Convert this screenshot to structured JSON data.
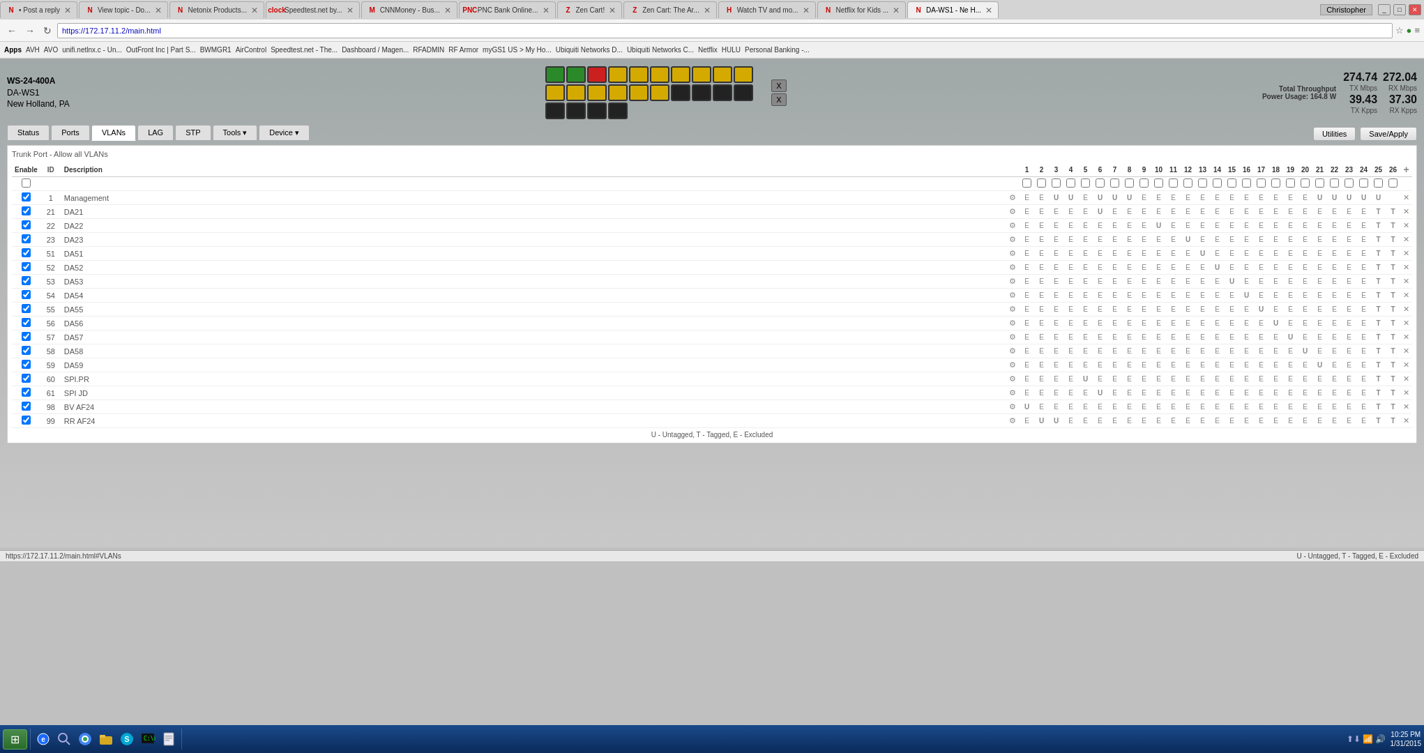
{
  "browser": {
    "tabs": [
      {
        "label": "• Post a reply",
        "active": false,
        "icon": "N"
      },
      {
        "label": "View topic - Do...",
        "active": false,
        "icon": "N"
      },
      {
        "label": "Netonix Products...",
        "active": false,
        "icon": "N"
      },
      {
        "label": "Speedtest.net by...",
        "active": false,
        "icon": "clock"
      },
      {
        "label": "CNNMoney - Bus...",
        "active": false,
        "icon": "M"
      },
      {
        "label": "PNC Bank Online...",
        "active": false,
        "icon": "PNC"
      },
      {
        "label": "Zen Cart!",
        "active": false,
        "icon": "Z"
      },
      {
        "label": "Zen Cart: The Ar...",
        "active": false,
        "icon": "Z"
      },
      {
        "label": "Watch TV and mo...",
        "active": false,
        "icon": "H"
      },
      {
        "label": "Netflix for Kids ...",
        "active": false,
        "icon": "N"
      },
      {
        "label": "DA-WS1 - Ne H...",
        "active": true,
        "icon": "N"
      }
    ],
    "address": "https://172.17.11.2/main.html",
    "user": "Christopher"
  },
  "bookmarks": [
    "Apps",
    "AVH",
    "AVO",
    "unifi.netlnx.c - Un...",
    "OutFront Inc | Part S...",
    "BWMGR1",
    "AirControl",
    "Speedtest.net - The...",
    "Dashboard / Magen...",
    "RFADMIN",
    "RF Armor",
    "myGS1 US > My Ho...",
    "Ubiquiti Networks D...",
    "Ubiquiti Networks C...",
    "Netflix",
    "HULU",
    "Personal Banking -..."
  ],
  "device": {
    "model": "WS-24-400A",
    "hostname": "DA-WS1",
    "location": "New Holland, PA"
  },
  "throughput": {
    "label": "Total Throughput",
    "power_label": "Power Usage:",
    "power_val": "164.8 W",
    "tx_mbps": "274.74",
    "rx_mbps": "272.04",
    "tx_label": "TX Mbps",
    "rx_label": "RX Mbps",
    "tx_kpps": "39.43",
    "rx_kpps": "37.30",
    "tx_kpps_label": "TX Kpps",
    "rx_kpps_label": "RX Kpps"
  },
  "nav_tabs": [
    "Status",
    "Ports",
    "VLANs",
    "LAG",
    "STP",
    "Tools",
    "Device"
  ],
  "toolbar": {
    "utilities_label": "Utilities",
    "save_label": "Save/Apply"
  },
  "trunk_label": "Trunk Port - Allow all VLANs",
  "table": {
    "headers": {
      "enable": "Enable",
      "id": "ID",
      "description": "Description",
      "ports": [
        "1",
        "2",
        "3",
        "4",
        "5",
        "6",
        "7",
        "8",
        "9",
        "10",
        "11",
        "12",
        "13",
        "14",
        "15",
        "16",
        "17",
        "18",
        "19",
        "20",
        "21",
        "22",
        "23",
        "24",
        "25",
        "26",
        "+"
      ]
    },
    "rows": [
      {
        "enable": true,
        "id": "1",
        "desc": "Management",
        "ports": [
          "E",
          "E",
          "U",
          "U",
          "E",
          "U",
          "U",
          "U",
          "E",
          "E",
          "E",
          "E",
          "E",
          "E",
          "E",
          "E",
          "E",
          "E",
          "E",
          "E",
          "U",
          "U",
          "U",
          "U",
          "U",
          ""
        ]
      },
      {
        "enable": true,
        "id": "21",
        "desc": "DA21",
        "ports": [
          "E",
          "E",
          "E",
          "E",
          "E",
          "U",
          "E",
          "E",
          "E",
          "E",
          "E",
          "E",
          "E",
          "E",
          "E",
          "E",
          "E",
          "E",
          "E",
          "E",
          "E",
          "E",
          "E",
          "E",
          "T",
          "T"
        ]
      },
      {
        "enable": true,
        "id": "22",
        "desc": "DA22",
        "ports": [
          "E",
          "E",
          "E",
          "E",
          "E",
          "E",
          "E",
          "E",
          "E",
          "U",
          "E",
          "E",
          "E",
          "E",
          "E",
          "E",
          "E",
          "E",
          "E",
          "E",
          "E",
          "E",
          "E",
          "E",
          "T",
          "T"
        ]
      },
      {
        "enable": true,
        "id": "23",
        "desc": "DA23",
        "ports": [
          "E",
          "E",
          "E",
          "E",
          "E",
          "E",
          "E",
          "E",
          "E",
          "E",
          "E",
          "U",
          "E",
          "E",
          "E",
          "E",
          "E",
          "E",
          "E",
          "E",
          "E",
          "E",
          "E",
          "E",
          "T",
          "T"
        ]
      },
      {
        "enable": true,
        "id": "51",
        "desc": "DA51",
        "ports": [
          "E",
          "E",
          "E",
          "E",
          "E",
          "E",
          "E",
          "E",
          "E",
          "E",
          "E",
          "E",
          "U",
          "E",
          "E",
          "E",
          "E",
          "E",
          "E",
          "E",
          "E",
          "E",
          "E",
          "E",
          "T",
          "T"
        ]
      },
      {
        "enable": true,
        "id": "52",
        "desc": "DA52",
        "ports": [
          "E",
          "E",
          "E",
          "E",
          "E",
          "E",
          "E",
          "E",
          "E",
          "E",
          "E",
          "E",
          "E",
          "U",
          "E",
          "E",
          "E",
          "E",
          "E",
          "E",
          "E",
          "E",
          "E",
          "E",
          "T",
          "T"
        ]
      },
      {
        "enable": true,
        "id": "53",
        "desc": "DA53",
        "ports": [
          "E",
          "E",
          "E",
          "E",
          "E",
          "E",
          "E",
          "E",
          "E",
          "E",
          "E",
          "E",
          "E",
          "E",
          "U",
          "E",
          "E",
          "E",
          "E",
          "E",
          "E",
          "E",
          "E",
          "E",
          "T",
          "T"
        ]
      },
      {
        "enable": true,
        "id": "54",
        "desc": "DA54",
        "ports": [
          "E",
          "E",
          "E",
          "E",
          "E",
          "E",
          "E",
          "E",
          "E",
          "E",
          "E",
          "E",
          "E",
          "E",
          "E",
          "U",
          "E",
          "E",
          "E",
          "E",
          "E",
          "E",
          "E",
          "E",
          "T",
          "T"
        ]
      },
      {
        "enable": true,
        "id": "55",
        "desc": "DA55",
        "ports": [
          "E",
          "E",
          "E",
          "E",
          "E",
          "E",
          "E",
          "E",
          "E",
          "E",
          "E",
          "E",
          "E",
          "E",
          "E",
          "E",
          "U",
          "E",
          "E",
          "E",
          "E",
          "E",
          "E",
          "E",
          "T",
          "T"
        ]
      },
      {
        "enable": true,
        "id": "56",
        "desc": "DA56",
        "ports": [
          "E",
          "E",
          "E",
          "E",
          "E",
          "E",
          "E",
          "E",
          "E",
          "E",
          "E",
          "E",
          "E",
          "E",
          "E",
          "E",
          "E",
          "U",
          "E",
          "E",
          "E",
          "E",
          "E",
          "E",
          "T",
          "T"
        ]
      },
      {
        "enable": true,
        "id": "57",
        "desc": "DA57",
        "ports": [
          "E",
          "E",
          "E",
          "E",
          "E",
          "E",
          "E",
          "E",
          "E",
          "E",
          "E",
          "E",
          "E",
          "E",
          "E",
          "E",
          "E",
          "E",
          "U",
          "E",
          "E",
          "E",
          "E",
          "E",
          "T",
          "T"
        ]
      },
      {
        "enable": true,
        "id": "58",
        "desc": "DA58",
        "ports": [
          "E",
          "E",
          "E",
          "E",
          "E",
          "E",
          "E",
          "E",
          "E",
          "E",
          "E",
          "E",
          "E",
          "E",
          "E",
          "E",
          "E",
          "E",
          "E",
          "U",
          "E",
          "E",
          "E",
          "E",
          "T",
          "T"
        ]
      },
      {
        "enable": true,
        "id": "59",
        "desc": "DA59",
        "ports": [
          "E",
          "E",
          "E",
          "E",
          "E",
          "E",
          "E",
          "E",
          "E",
          "E",
          "E",
          "E",
          "E",
          "E",
          "E",
          "E",
          "E",
          "E",
          "E",
          "E",
          "U",
          "E",
          "E",
          "E",
          "T",
          "T"
        ]
      },
      {
        "enable": true,
        "id": "60",
        "desc": "SPI.PR",
        "ports": [
          "E",
          "E",
          "E",
          "E",
          "U",
          "E",
          "E",
          "E",
          "E",
          "E",
          "E",
          "E",
          "E",
          "E",
          "E",
          "E",
          "E",
          "E",
          "E",
          "E",
          "E",
          "E",
          "E",
          "E",
          "T",
          "T"
        ]
      },
      {
        "enable": true,
        "id": "61",
        "desc": "SPI JD",
        "ports": [
          "E",
          "E",
          "E",
          "E",
          "E",
          "U",
          "E",
          "E",
          "E",
          "E",
          "E",
          "E",
          "E",
          "E",
          "E",
          "E",
          "E",
          "E",
          "E",
          "E",
          "E",
          "E",
          "E",
          "E",
          "T",
          "T"
        ]
      },
      {
        "enable": true,
        "id": "98",
        "desc": "BV AF24",
        "ports": [
          "U",
          "E",
          "E",
          "E",
          "E",
          "E",
          "E",
          "E",
          "E",
          "E",
          "E",
          "E",
          "E",
          "E",
          "E",
          "E",
          "E",
          "E",
          "E",
          "E",
          "E",
          "E",
          "E",
          "E",
          "T",
          "T"
        ]
      },
      {
        "enable": true,
        "id": "99",
        "desc": "RR AF24",
        "ports": [
          "E",
          "U",
          "U",
          "E",
          "E",
          "E",
          "E",
          "E",
          "E",
          "E",
          "E",
          "E",
          "E",
          "E",
          "E",
          "E",
          "E",
          "E",
          "E",
          "E",
          "E",
          "E",
          "E",
          "E",
          "T",
          "T"
        ]
      }
    ]
  },
  "legend": "U - Untagged, T - Tagged, E - Excluded",
  "status_bar_url": "https://172.17.11.2/main.html#VLANs",
  "taskbar": {
    "time": "10:25 PM",
    "date": "1/31/2015"
  },
  "ports_display": {
    "colors": [
      "green",
      "red",
      "yellow",
      "yellow",
      "yellow",
      "yellow",
      "yellow",
      "yellow",
      "yellow",
      "yellow",
      "yellow",
      "yellow",
      "yellow",
      "yellow",
      "yellow",
      "yellow",
      "black",
      "black",
      "black",
      "black",
      "black",
      "black",
      "black",
      "black"
    ]
  }
}
